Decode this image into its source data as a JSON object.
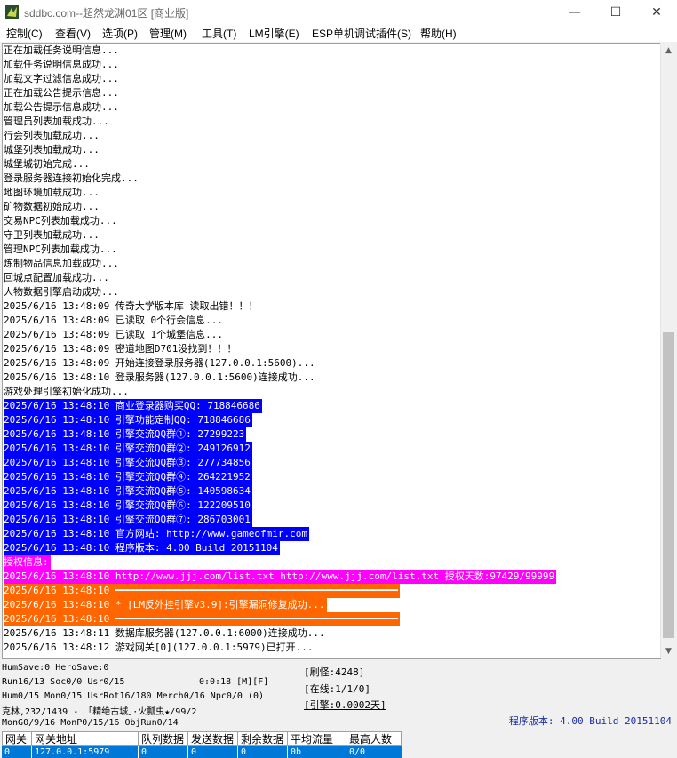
{
  "window": {
    "title": "sddbc.com--超然龙渊01区 [商业版]",
    "minimize_glyph": "—",
    "maximize_glyph": "☐",
    "close_glyph": "✕",
    "app_icon": "app-icon"
  },
  "menu": [
    {
      "label": "控制(C)"
    },
    {
      "label": "查看(V)"
    },
    {
      "label": "选项(P)"
    },
    {
      "label": "管理(M)"
    },
    {
      "label": "工具(T)"
    },
    {
      "label": "LM引擎(E)"
    },
    {
      "label": "ESP单机调试插件(S)"
    },
    {
      "label": "帮助(H)"
    }
  ],
  "log": [
    {
      "text": "正在加载任务说明信息...",
      "hl": ""
    },
    {
      "text": "加载任务说明信息成功...",
      "hl": ""
    },
    {
      "text": "加载文字过滤信息成功...",
      "hl": ""
    },
    {
      "text": "正在加载公告提示信息...",
      "hl": ""
    },
    {
      "text": "加载公告提示信息成功...",
      "hl": ""
    },
    {
      "text": "管理员列表加载成功...",
      "hl": ""
    },
    {
      "text": "行会列表加载成功...",
      "hl": ""
    },
    {
      "text": "城堡列表加载成功...",
      "hl": ""
    },
    {
      "text": "城堡城初始完成...",
      "hl": ""
    },
    {
      "text": "登录服务器连接初始化完成...",
      "hl": ""
    },
    {
      "text": "地图环境加载成功...",
      "hl": ""
    },
    {
      "text": "矿物数据初始成功...",
      "hl": ""
    },
    {
      "text": "交易NPC列表加载成功...",
      "hl": ""
    },
    {
      "text": "守卫列表加载成功...",
      "hl": ""
    },
    {
      "text": "管理NPC列表加载成功...",
      "hl": ""
    },
    {
      "text": "炼制物品信息加载成功...",
      "hl": ""
    },
    {
      "text": "回城点配置加载成功...",
      "hl": ""
    },
    {
      "text": "人物数据引擎启动成功...",
      "hl": ""
    },
    {
      "text": "2025/6/16 13:48:09 传奇大学版本库 读取出错！！！",
      "hl": ""
    },
    {
      "text": "2025/6/16 13:48:09 已读取 0个行会信息...",
      "hl": ""
    },
    {
      "text": "2025/6/16 13:48:09 已读取 1个城堡信息...",
      "hl": ""
    },
    {
      "text": "2025/6/16 13:48:09 密道地图D701没找到！！！",
      "hl": ""
    },
    {
      "text": "2025/6/16 13:48:09 开始连接登录服务器(127.0.0.1:5600)...",
      "hl": ""
    },
    {
      "text": "2025/6/16 13:48:10 登录服务器(127.0.0.1:5600)连接成功...",
      "hl": ""
    },
    {
      "text": "游戏处理引擎初始化成功...",
      "hl": ""
    },
    {
      "text": "2025/6/16 13:48:10 商业登录器购买QQ: 718846686",
      "hl": "blue"
    },
    {
      "text": "2025/6/16 13:48:10 引擎功能定制QQ: 718846686",
      "hl": "blue"
    },
    {
      "text": "2025/6/16 13:48:10 引擎交流QQ群①: 27299223",
      "hl": "blue"
    },
    {
      "text": "2025/6/16 13:48:10 引擎交流QQ群②: 249126912",
      "hl": "blue"
    },
    {
      "text": "2025/6/16 13:48:10 引擎交流QQ群③: 277734856",
      "hl": "blue"
    },
    {
      "text": "2025/6/16 13:48:10 引擎交流QQ群④: 264221952",
      "hl": "blue"
    },
    {
      "text": "2025/6/16 13:48:10 引擎交流QQ群⑤: 140598634",
      "hl": "blue"
    },
    {
      "text": "2025/6/16 13:48:10 引擎交流QQ群⑥: 122209510",
      "hl": "blue"
    },
    {
      "text": "2025/6/16 13:48:10 引擎交流QQ群⑦: 286703001",
      "hl": "blue"
    },
    {
      "text": "2025/6/16 13:48:10 官方网站: http://www.gameofmir.com",
      "hl": "blue"
    },
    {
      "text": "2025/6/16 13:48:10 程序版本: 4.00 Build 20151104",
      "hl": "blue"
    },
    {
      "text": "授权信息:",
      "hl": "magenta"
    },
    {
      "text": "2025/6/16 13:48:10 http://www.jjj.com/list.txt http://www.jjj.com/list.txt 授权天数:97429/99999",
      "hl": "magenta"
    },
    {
      "text": "2025/6/16 13:48:10 ━━━━━━━━━━━━━━━━━━━━━━━━━━━━━━━━━━━━━━━━━━━━━━━━",
      "hl": "orange"
    },
    {
      "text": "2025/6/16 13:48:10 * [LM反外挂引擎v3.9]:引擎漏洞修复成功...",
      "hl": "orange"
    },
    {
      "text": "2025/6/16 13:48:10 ━━━━━━━━━━━━━━━━━━━━━━━━━━━━━━━━━━━━━━━━━━━━━━━━",
      "hl": "orange"
    },
    {
      "text": "2025/6/16 13:48:11 数据库服务器(127.0.0.1:6000)连接成功...",
      "hl": ""
    },
    {
      "text": "2025/6/16 13:48:12 游戏网关[0](127.0.0.1:5979)已打开...",
      "hl": ""
    }
  ],
  "status": {
    "line1": "HumSave:0 HeroSave:0",
    "line2": "Run16/13 Soc0/0 Usr0/15",
    "line2b": "0:0:18 [M][F]",
    "line3": "Hum0/15 Mon0/15 UsrRot16/180 Merch0/16 Npc0/0 (0)",
    "line4": "克林,232/1439 - 「精绝古城」·火瓢虫★/99/2",
    "line5": "MonG0/9/16 MonP0/15/16 ObjRun0/14",
    "refresh": "[刷怪:4248]",
    "online": "[在线:1/1/0]",
    "engine": "[引擎:0.0002天]",
    "version": "程序版本: 4.00 Build 20151104"
  },
  "gate_table": {
    "headers": [
      "网关",
      "网关地址",
      "队列数据",
      "发送数据",
      "剩余数据",
      "平均流量",
      "最高人数"
    ],
    "row": [
      "0",
      "127.0.0.1:5979",
      "0",
      "0",
      "0",
      "0b",
      "0/0"
    ]
  },
  "colors": {
    "highlight_blue": "#0000ff",
    "highlight_magenta": "#ff00ff",
    "highlight_orange": "#ff6600",
    "row_selected": "#0078d7",
    "version_text": "#1a2e9e"
  }
}
